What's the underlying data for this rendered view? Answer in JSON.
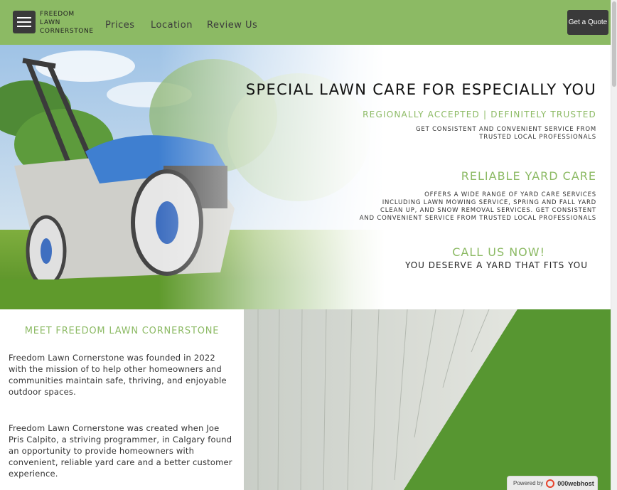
{
  "header": {
    "brand": "FREEDOM\nLAWN\nCORNERSTONE",
    "nav": [
      {
        "label": "Prices"
      },
      {
        "label": "Location"
      },
      {
        "label": "Review Us"
      }
    ],
    "quote_button": "Get a Quote",
    "menu_icon": "hamburger-icon",
    "colors": {
      "bar": "#8cba64",
      "dark": "#3a3a3a"
    }
  },
  "hero": {
    "title": "SPECIAL LAWN CARE FOR ESPECIALLY YOU",
    "subtitle": "REGIONALLY ACCEPTED | DEFINITELY TRUSTED",
    "subtitle_body": "GET CONSISTENT AND CONVENIENT SERVICE FROM\nTRUSTED LOCAL PROFESSIONALS",
    "section_heading": "RELIABLE YARD CARE",
    "section_body": "OFFERS A WIDE RANGE OF YARD CARE SERVICES\nINCLUDING LAWN MOWING SERVICE, SPRING AND FALL YARD\nCLEAN UP, AND SNOW REMOVAL SERVICES. GET CONSISTENT\nAND CONVENIENT SERVICE FROM TRUSTED LOCAL PROFESSIONALS",
    "cta": "CALL US NOW!",
    "cta_sub": "YOU DESERVE A YARD THAT FITS YOU",
    "accent": "#8cba64"
  },
  "about": {
    "title": "MEET FREEDOM LAWN CORNERSTONE",
    "paragraphs": [
      "Freedom Lawn Cornerstone was founded in 2022 with the mission of to help other homeowners and communities maintain safe, thriving, and enjoyable outdoor spaces.",
      "Freedom Lawn Cornerstone was created when Joe Pris Calpito, a striving programmer, in Calgary found an opportunity to provide homeowners with convenient, reliable yard care and a better customer experience."
    ]
  },
  "badge": {
    "powered_by": "Powered by",
    "host": "000webhost"
  }
}
